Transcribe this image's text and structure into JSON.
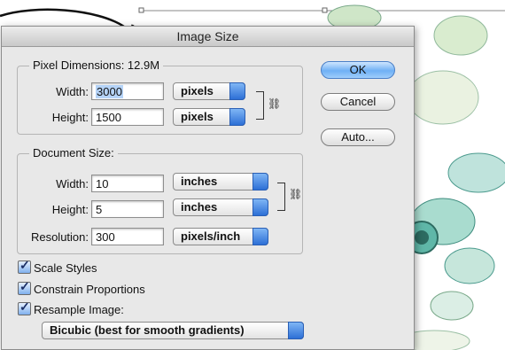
{
  "dialog": {
    "title": "Image Size"
  },
  "pixel_dimensions": {
    "legend": "Pixel Dimensions: 12.9M",
    "width_label": "Width:",
    "width_value": "3000",
    "width_unit": "pixels",
    "height_label": "Height:",
    "height_value": "1500",
    "height_unit": "pixels"
  },
  "document_size": {
    "legend": "Document Size:",
    "width_label": "Width:",
    "width_value": "10",
    "width_unit": "inches",
    "height_label": "Height:",
    "height_value": "5",
    "height_unit": "inches",
    "resolution_label": "Resolution:",
    "resolution_value": "300",
    "resolution_unit": "pixels/inch"
  },
  "buttons": {
    "ok": "OK",
    "cancel": "Cancel",
    "auto": "Auto..."
  },
  "options": {
    "scale_styles": "Scale Styles",
    "constrain_proportions": "Constrain Proportions",
    "resample_image": "Resample Image:",
    "resample_method": "Bicubic (best for smooth gradients)"
  },
  "colors": {
    "accent": "#2d6fd6",
    "selection": "#b5d3f7",
    "flower_teal": "#5fb7a8"
  }
}
